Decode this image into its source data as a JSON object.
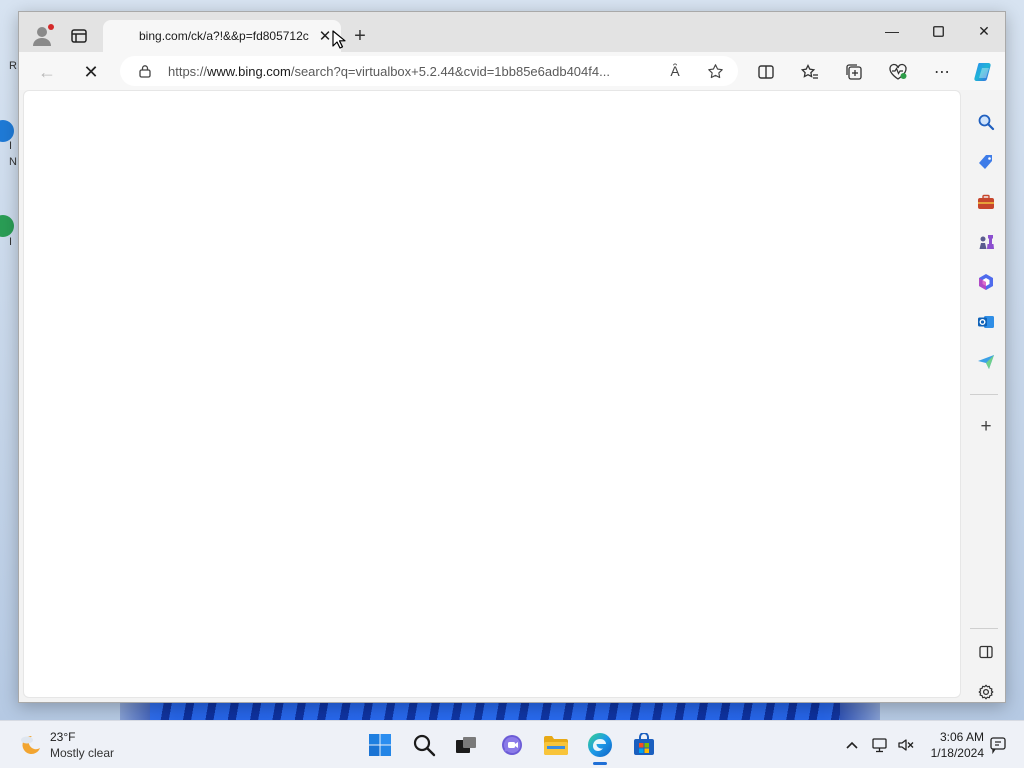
{
  "desktop": {
    "fragments": [
      "R",
      "I",
      "N",
      "I"
    ]
  },
  "browser": {
    "tab": {
      "title": "bing.com/ck/a?!&&p=fd805712c",
      "close_icon": "close-icon"
    },
    "window_controls": {
      "minimize": "minimize-icon",
      "maximize": "maximize-icon",
      "close": "close-icon"
    },
    "address": {
      "url_prefix": "https://",
      "url_domain": "www.bing.com",
      "url_rest": "/search?q=virtualbox+5.2.44&cvid=1bb85e6adb404f4..."
    },
    "toolbar_icons": [
      "back-icon",
      "stop-loading-icon",
      "lock-icon",
      "read-aloud-icon",
      "favorite-star-icon",
      "split-screen-icon",
      "favorites-icon",
      "collections-icon",
      "browser-essentials-icon",
      "more-icon",
      "copilot-icon"
    ],
    "read_aloud_glyph": "Ȃ",
    "sidebar_icons": [
      "search-icon",
      "shopping-icon",
      "tools-icon",
      "games-icon",
      "microsoft365-icon",
      "outlook-icon",
      "drop-icon",
      "add-icon",
      "hide-sidebar-icon",
      "settings-icon"
    ],
    "colors": {
      "accent": "#1f6fd6",
      "titlebar": "#e3e3e3",
      "toolbar": "#f7f7f7"
    }
  },
  "taskbar": {
    "weather": {
      "temperature": "23°F",
      "description": "Mostly clear"
    },
    "apps": [
      "start-icon",
      "search-icon",
      "task-view-icon",
      "chat-icon",
      "file-explorer-icon",
      "edge-icon",
      "store-icon"
    ],
    "tray": [
      "show-hidden-icons-icon",
      "network-icon",
      "volume-muted-icon",
      "notifications-icon"
    ],
    "clock": {
      "time": "3:06 AM",
      "date": "1/18/2024"
    }
  }
}
